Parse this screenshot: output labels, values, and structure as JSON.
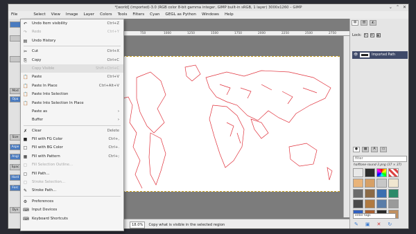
{
  "window": {
    "title": "*[world] (imported)-3.0 (RGB color 8-bit gamma integer, GIMP built-in sRGB, 1 layer) 3000x1260 – GIMP",
    "controls": [
      "⌄",
      "⌃",
      "✕"
    ]
  },
  "menubar": [
    "File",
    "",
    "Select",
    "View",
    "Image",
    "Layer",
    "Colors",
    "Tools",
    "Filters",
    "Cyan",
    "GEGL as Python",
    "Windows",
    "Help"
  ],
  "edit_menu": {
    "items": [
      {
        "label": "Undo Item visibility",
        "shortcut": "Ctrl+Z",
        "icon": "↶",
        "enabled": true
      },
      {
        "label": "Redo",
        "shortcut": "Ctrl+Y",
        "icon": "↷",
        "enabled": false
      },
      {
        "label": "Undo History",
        "shortcut": "",
        "icon": "▤",
        "enabled": true
      },
      {
        "sep": true
      },
      {
        "label": "Cut",
        "shortcut": "Ctrl+X",
        "icon": "✂",
        "enabled": true
      },
      {
        "label": "Copy",
        "shortcut": "Ctrl+C",
        "icon": "⎘",
        "enabled": true
      },
      {
        "label": "Copy Visible",
        "shortcut": "Shift+Ctrl+C",
        "icon": "",
        "enabled": false,
        "highlight": true
      },
      {
        "label": "Paste",
        "shortcut": "Ctrl+V",
        "icon": "📋",
        "enabled": true
      },
      {
        "label": "Paste In Place",
        "shortcut": "Ctrl+Alt+V",
        "icon": "📋",
        "enabled": true
      },
      {
        "label": "Paste Into Selection",
        "shortcut": "",
        "icon": "📋",
        "enabled": true
      },
      {
        "label": "Paste Into Selection In Place",
        "shortcut": "",
        "icon": "📋",
        "enabled": true
      },
      {
        "label": "Paste as",
        "shortcut": "",
        "icon": "",
        "enabled": true,
        "submenu": true
      },
      {
        "label": "Buffer",
        "shortcut": "",
        "icon": "",
        "enabled": true,
        "submenu": true
      },
      {
        "sep": true
      },
      {
        "label": "Clear",
        "shortcut": "Delete",
        "icon": "✗",
        "enabled": true
      },
      {
        "label": "Fill with FG Color",
        "shortcut": "Ctrl+,",
        "icon": "■",
        "enabled": true
      },
      {
        "label": "Fill with BG Color",
        "shortcut": "Ctrl+.",
        "icon": "□",
        "enabled": true
      },
      {
        "label": "Fill with Pattern",
        "shortcut": "Ctrl+;",
        "icon": "▦",
        "enabled": true
      },
      {
        "label": "Fill Selection Outline...",
        "shortcut": "",
        "icon": "▢",
        "enabled": false
      },
      {
        "label": "Fill Path...",
        "shortcut": "",
        "icon": "▢",
        "enabled": true
      },
      {
        "label": "Stroke Selection...",
        "shortcut": "",
        "icon": "▢",
        "enabled": false
      },
      {
        "label": "Stroke Path...",
        "shortcut": "",
        "icon": "✎",
        "enabled": true
      },
      {
        "sep": true
      },
      {
        "label": "Preferences",
        "shortcut": "",
        "icon": "⚙",
        "enabled": true
      },
      {
        "label": "Input Devices",
        "shortcut": "",
        "icon": "⌨",
        "enabled": true
      },
      {
        "label": "Keyboard Shortcuts",
        "shortcut": "",
        "icon": "⌨",
        "enabled": true
      }
    ]
  },
  "toolbox": {
    "labels": [
      "Mod",
      "Opa",
      "Size",
      "Aspe",
      "Angl",
      "Spac",
      "Hard",
      "Forc",
      "Dyn"
    ]
  },
  "ruler": {
    "ticks": [
      "750",
      "1000",
      "1250",
      "1500",
      "1750",
      "2000",
      "2250",
      "2500",
      "2750"
    ]
  },
  "status": {
    "zoom": "18.0%",
    "message": "Copy what is visible in the selected region"
  },
  "layers": {
    "lock_label": "Lock:",
    "layer_name": "Imported Path"
  },
  "brushes": {
    "filter_placeholder": "filter",
    "current_brush": "halftone-round-3.png (37 × 37)",
    "tag_placeholder": "enter tags"
  },
  "colors": {
    "accent": "#3d7dd1",
    "map_stroke": "#e0303a",
    "layer_selected": "#3f4a69"
  }
}
